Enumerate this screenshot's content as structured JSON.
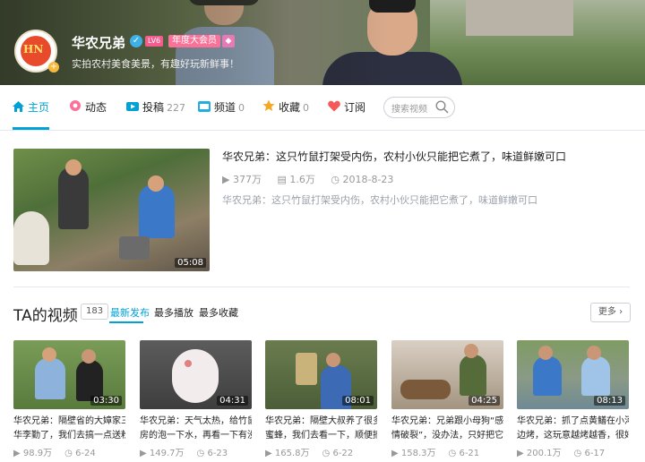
{
  "profile": {
    "name": "华农兄弟",
    "level": "LV6",
    "vip_badge": "年度大会员",
    "signature": "实拍农村美食美景，有趣好玩新鲜事！",
    "logo_text": "HN"
  },
  "nav": {
    "items": [
      {
        "label": "主页",
        "count": "",
        "icon": "home-icon"
      },
      {
        "label": "动态",
        "count": "",
        "icon": "dynamic-icon"
      },
      {
        "label": "投稿",
        "count": "227",
        "icon": "upload-icon"
      },
      {
        "label": "频道",
        "count": "0",
        "icon": "channel-icon"
      },
      {
        "label": "收藏",
        "count": "0",
        "icon": "star-icon"
      },
      {
        "label": "订阅",
        "count": "",
        "icon": "heart-icon"
      }
    ],
    "search_placeholder": "搜索视频"
  },
  "featured": {
    "title": "华农兄弟：这只竹鼠打架受内伤，农村小伙只能把它煮了，味道鲜嫩可口",
    "plays": "377万",
    "comments": "1.6万",
    "date": "2018-8-23",
    "description": "华农兄弟：这只竹鼠打架受内伤，农村小伙只能把它煮了，味道鲜嫩可口",
    "duration": "05:08"
  },
  "videos_section": {
    "title": "TA的视频",
    "count": "183",
    "sort_options": [
      "最新发布",
      "最多播放",
      "最多收藏"
    ],
    "more_label": "更多"
  },
  "videos": [
    {
      "title1": "华农兄弟：隔壁省的大嫜家三",
      "title2": "华李勤了，我们去搞一点送粉",
      "plays": "98.9万",
      "date": "6-24",
      "duration": "03:30"
    },
    {
      "title1": "华农兄弟：天气太热，给竹鼠",
      "title2": "房的泡一下水，再看一下有没",
      "plays": "149.7万",
      "date": "6-23",
      "duration": "04:31"
    },
    {
      "title1": "华农兄弟：隔壁大叔养了很多",
      "title2": "蜜蜂，我们去看一下，顺便摘",
      "plays": "165.8万",
      "date": "6-22",
      "duration": "08:01"
    },
    {
      "title1": "华农兄弟：兄弟跟小母狗“感",
      "title2": "情破裂”，没办法，只好把它",
      "plays": "158.3万",
      "date": "6-21",
      "duration": "04:25"
    },
    {
      "title1": "华农兄弟：抓了点黄鳝在小河",
      "title2": "边烤，这玩意越烤越香，很好",
      "plays": "200.1万",
      "date": "6-17",
      "duration": "08:13"
    }
  ],
  "colors": {
    "accent": "#00a1d6",
    "vip": "#fb7299",
    "level": "#f25d8e"
  }
}
